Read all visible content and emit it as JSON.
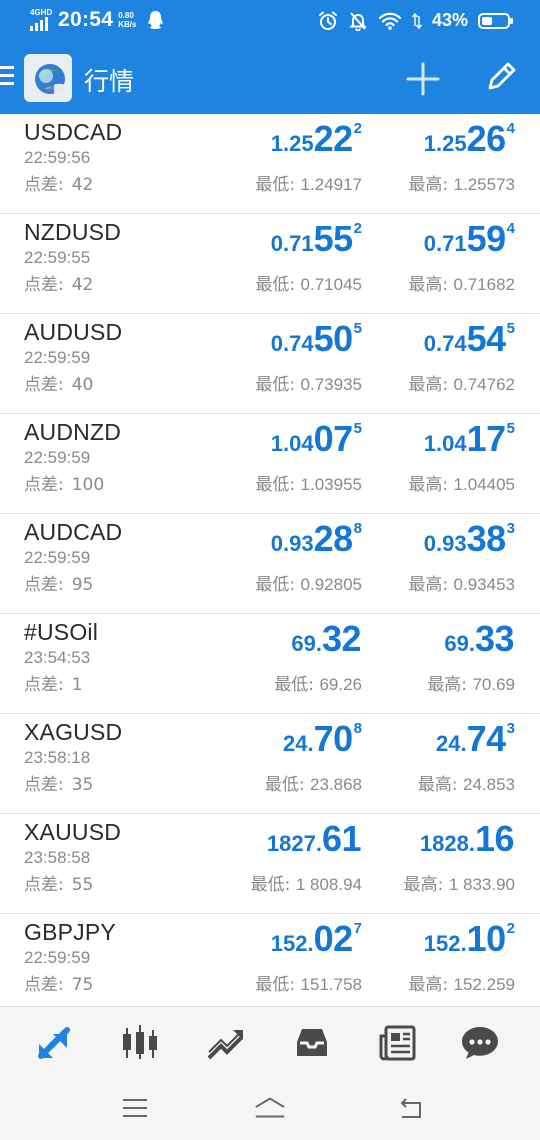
{
  "status_bar": {
    "network": "4GHD",
    "time": "20:54",
    "speed_value": "0.80",
    "speed_unit": "KB/s",
    "battery_percent": "43%",
    "battery_level": 0.43
  },
  "app_bar": {
    "title": "行情",
    "icons": [
      "menu-icon",
      "app-logo",
      "add-icon",
      "edit-icon"
    ]
  },
  "quotes": [
    {
      "symbol": "USDCAD",
      "time": "22:59:56",
      "spread_label": "点差:",
      "spread": "42",
      "bid": {
        "p1": "1.25",
        "p2": "22",
        "p3": "2"
      },
      "ask": {
        "p1": "1.25",
        "p2": "26",
        "p3": "4"
      },
      "low_label": "最低:",
      "low": "1.24917",
      "high_label": "最高:",
      "high": "1.25573"
    },
    {
      "symbol": "NZDUSD",
      "time": "22:59:55",
      "spread_label": "点差:",
      "spread": "42",
      "bid": {
        "p1": "0.71",
        "p2": "55",
        "p3": "2"
      },
      "ask": {
        "p1": "0.71",
        "p2": "59",
        "p3": "4"
      },
      "low_label": "最低:",
      "low": "0.71045",
      "high_label": "最高:",
      "high": "0.71682"
    },
    {
      "symbol": "AUDUSD",
      "time": "22:59:59",
      "spread_label": "点差:",
      "spread": "40",
      "bid": {
        "p1": "0.74",
        "p2": "50",
        "p3": "5"
      },
      "ask": {
        "p1": "0.74",
        "p2": "54",
        "p3": "5"
      },
      "low_label": "最低:",
      "low": "0.73935",
      "high_label": "最高:",
      "high": "0.74762"
    },
    {
      "symbol": "AUDNZD",
      "time": "22:59:59",
      "spread_label": "点差:",
      "spread": "100",
      "bid": {
        "p1": "1.04",
        "p2": "07",
        "p3": "5"
      },
      "ask": {
        "p1": "1.04",
        "p2": "17",
        "p3": "5"
      },
      "low_label": "最低:",
      "low": "1.03955",
      "high_label": "最高:",
      "high": "1.04405"
    },
    {
      "symbol": "AUDCAD",
      "time": "22:59:59",
      "spread_label": "点差:",
      "spread": "95",
      "bid": {
        "p1": "0.93",
        "p2": "28",
        "p3": "8"
      },
      "ask": {
        "p1": "0.93",
        "p2": "38",
        "p3": "3"
      },
      "low_label": "最低:",
      "low": "0.92805",
      "high_label": "最高:",
      "high": "0.93453"
    },
    {
      "symbol": "#USOil",
      "time": "23:54:53",
      "spread_label": "点差:",
      "spread": "1",
      "bid": {
        "p1": "69.",
        "p2": "32",
        "p3": ""
      },
      "ask": {
        "p1": "69.",
        "p2": "33",
        "p3": ""
      },
      "low_label": "最低:",
      "low": "69.26",
      "high_label": "最高:",
      "high": "70.69"
    },
    {
      "symbol": "XAGUSD",
      "time": "23:58:18",
      "spread_label": "点差:",
      "spread": "35",
      "bid": {
        "p1": "24.",
        "p2": "70",
        "p3": "8"
      },
      "ask": {
        "p1": "24.",
        "p2": "74",
        "p3": "3"
      },
      "low_label": "最低:",
      "low": "23.868",
      "high_label": "最高:",
      "high": "24.853"
    },
    {
      "symbol": "XAUUSD",
      "time": "23:58:58",
      "spread_label": "点差:",
      "spread": "55",
      "bid": {
        "p1": "1827.",
        "p2": "61",
        "p3": ""
      },
      "ask": {
        "p1": "1828.",
        "p2": "16",
        "p3": ""
      },
      "low_label": "最低:",
      "low": "1 808.94",
      "high_label": "最高:",
      "high": "1 833.90"
    },
    {
      "symbol": "GBPJPY",
      "time": "22:59:59",
      "spread_label": "点差:",
      "spread": "75",
      "bid": {
        "p1": "152.",
        "p2": "02",
        "p3": "7"
      },
      "ask": {
        "p1": "152.",
        "p2": "10",
        "p3": "2"
      },
      "low_label": "最低:",
      "low": "151.758",
      "high_label": "最高:",
      "high": "152.259"
    }
  ],
  "tab_bar": {
    "tabs": [
      {
        "icon": "quotes-arrows-icon",
        "active": true
      },
      {
        "icon": "candlestick-chart-icon",
        "active": false
      },
      {
        "icon": "trade-trend-icon",
        "active": false
      },
      {
        "icon": "inbox-icon",
        "active": false
      },
      {
        "icon": "news-icon",
        "active": false
      },
      {
        "icon": "chat-bubble-icon",
        "active": false
      }
    ],
    "active_color": "#1f84e0",
    "inactive_color": "#4a4a4a"
  },
  "system_nav": {
    "icons": [
      "recents-menu-icon",
      "home-icon",
      "back-icon"
    ]
  },
  "colors": {
    "brand_blue": "#1f84e0",
    "price_blue": "#1477d6",
    "secondary_text": "#8a8a8a"
  }
}
